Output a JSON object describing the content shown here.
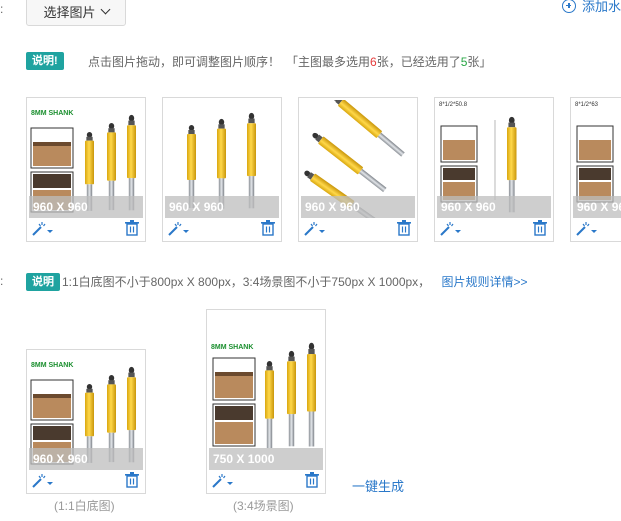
{
  "top": {
    "select_button": "选择图片",
    "add_link": "添加水"
  },
  "main_images": {
    "badge": "说明!",
    "tip_main": "点击图片拖动，即可调整图片顺序！",
    "tip_bracket_open": "「主图最多选用",
    "max_count": "6",
    "tip_mid": "张，已经选用了",
    "used_count": "5",
    "tip_bracket_close": "张」",
    "cards": [
      {
        "size_label": "960 X 960",
        "brand": "8MM SHANK"
      },
      {
        "size_label": "960 X 960"
      },
      {
        "size_label": "960 X 960"
      },
      {
        "size_label": "960 X 960",
        "spec": "8*1/2*50.8"
      },
      {
        "size_label": "960 X 96",
        "spec": "8*1/2*63"
      }
    ]
  },
  "rules": {
    "badge": "说明",
    "text": "1:1白底图不小于800px X 800px，3:4场景图不小于750px X 1000px，",
    "link": "图片规则详情>>"
  },
  "generated": {
    "cards": [
      {
        "size_label": "960 X 960",
        "brand": "8MM SHANK",
        "caption": "(1:1白底图)"
      },
      {
        "size_label": "750 X 1000",
        "brand": "8MM SHANK",
        "caption": "(3:4场景图)"
      }
    ],
    "generate_link": "一键生成"
  },
  "colors": {
    "accent_teal": "#1fa3a0",
    "link_blue": "#2a78c9",
    "bit_yellow": "#f2c21b"
  }
}
